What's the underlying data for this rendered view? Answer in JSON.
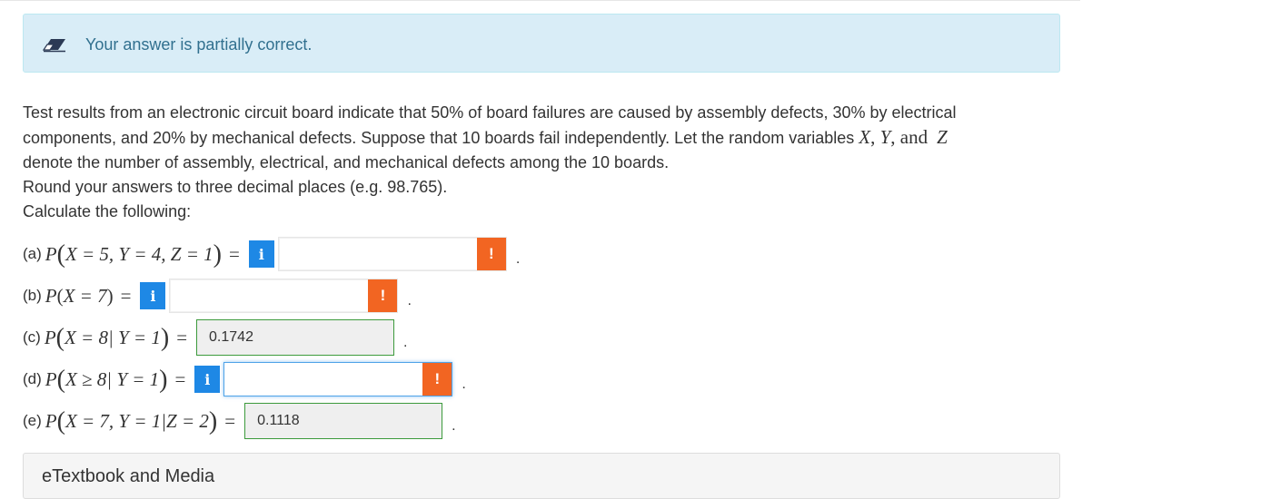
{
  "banner": {
    "message": "Your answer is partially correct.",
    "icon": "pencil-eraser-icon",
    "bg": "#d9edf7",
    "text_color": "#31708f"
  },
  "question": {
    "line1": "Test results from an electronic circuit board indicate that 50% of board failures are caused by assembly defects, 30% by electrical",
    "line2_a": "components, and 20% by mechanical defects. Suppose that 10 boards fail independently. Let the random variables ",
    "var_x": "X",
    "comma1": ", ",
    "var_y": "Y",
    "comma2": ", ",
    "and": "and",
    "var_z": "Z",
    "line3": "denote the number of assembly, electrical, and mechanical defects among the 10 boards.",
    "line4": "Round your answers to three decimal places (e.g. 98.765).",
    "line5": "Calculate the following:"
  },
  "parts": [
    {
      "label": "(a)",
      "expr_prefix": "P",
      "expr_inner": "X = 5,  Y = 4,  Z = 1",
      "value": "",
      "status": "incorrect"
    },
    {
      "label": "(b)",
      "expr_prefix": "P",
      "expr_inner": "X = 7",
      "value": "",
      "status": "incorrect"
    },
    {
      "label": "(c)",
      "expr_prefix": "P",
      "expr_inner": "X = 8| Y = 1",
      "value": "0.1742",
      "status": "correct"
    },
    {
      "label": "(d)",
      "expr_prefix": "P",
      "expr_inner": "X ≥ 8| Y = 1",
      "value": "",
      "status": "incorrect"
    },
    {
      "label": "(e)",
      "expr_prefix": "P",
      "expr_inner": "X = 7,  Y = 1|Z = 2",
      "value": "0.1118",
      "status": "correct"
    }
  ],
  "symbols": {
    "equals": "=",
    "info": "i",
    "warn": "!",
    "period": "."
  },
  "media": {
    "label": "eTextbook and Media"
  },
  "colors": {
    "info": "#1e88e5",
    "warn": "#f26522",
    "correct_border": "#3c9a3c"
  }
}
